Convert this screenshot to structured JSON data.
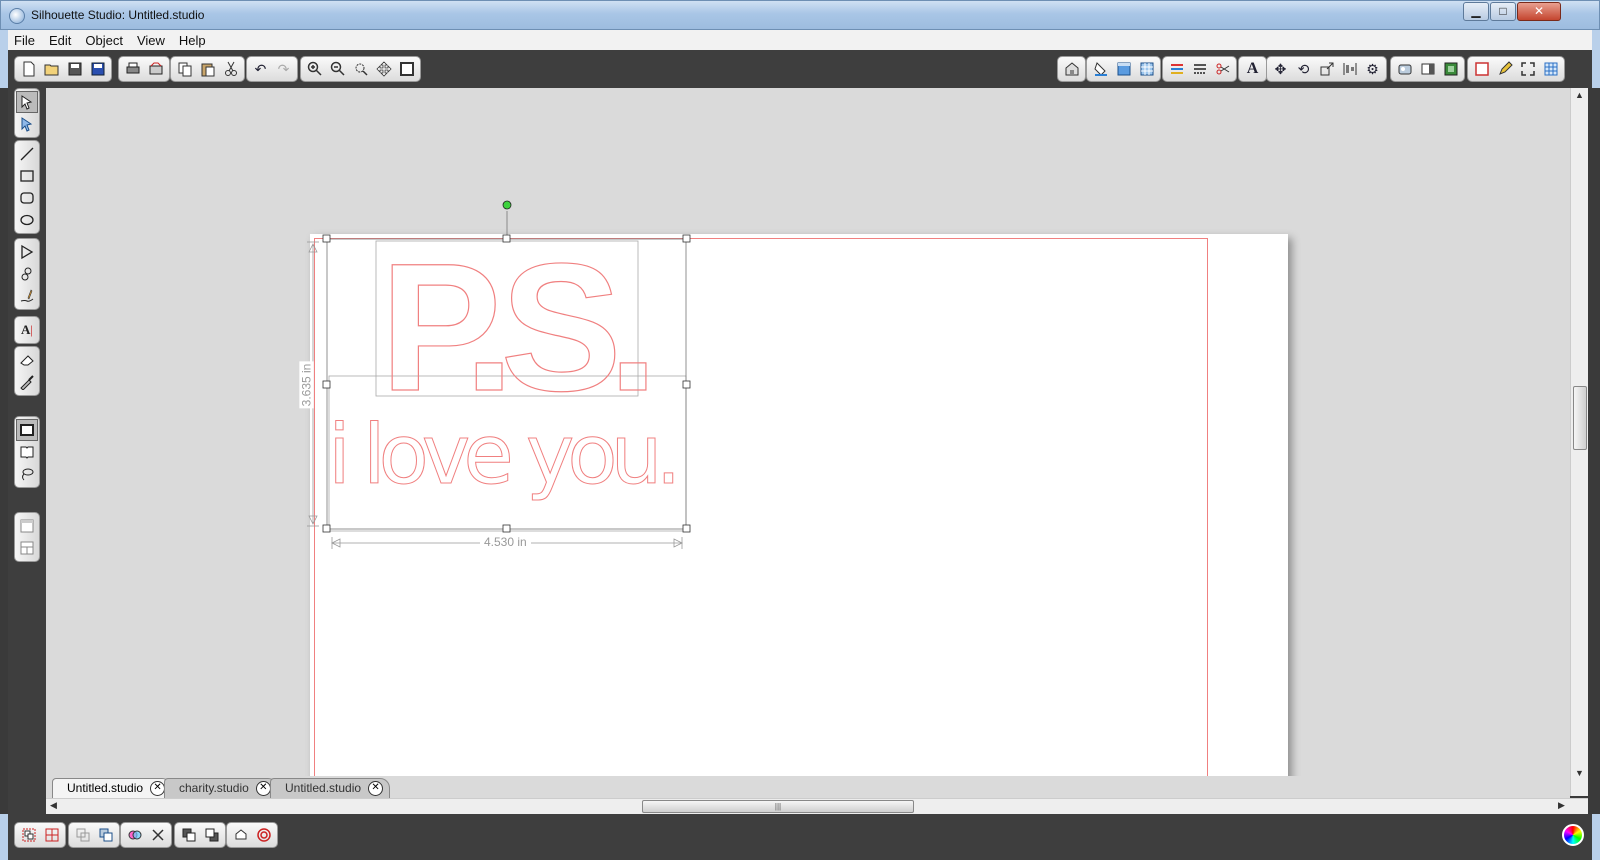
{
  "window": {
    "title": "Silhouette Studio: Untitled.studio",
    "buttons": {
      "minimize": "▁",
      "maximize": "□",
      "close": "✕"
    }
  },
  "menu": [
    "File",
    "Edit",
    "Object",
    "View",
    "Help"
  ],
  "toolbar_icons_left": [
    "new-icon",
    "open-icon",
    "save-icon",
    "save-to-library-icon",
    "print-icon",
    "print-cut-icon",
    "copy-icon",
    "paste-icon",
    "cut-icon",
    "undo-icon",
    "redo-icon",
    "zoom-in-icon",
    "zoom-out-icon",
    "zoom-select-icon",
    "pan-icon",
    "fit-page-icon"
  ],
  "toolbar_icons_right": [
    "store-icon",
    "fill-color-icon",
    "page-setup-icon",
    "registration-icon",
    "line-color-icon",
    "line-style-icon",
    "cut-settings-icon",
    "text-icon",
    "replicate-icon",
    "rotate-icon",
    "scale-icon",
    "align-icon",
    "transform-icon",
    "offset-icon",
    "trace-icon",
    "library-icon",
    "sketch-icon",
    "fullscreen-icon",
    "grid-icon"
  ],
  "left_tools": [
    "select-tool",
    "edit-points-tool",
    "line-tool",
    "rectangle-tool",
    "rounded-rectangle-tool",
    "ellipse-tool",
    "polygon-tool",
    "curve-tool",
    "freehand-tool",
    "text-tool",
    "eraser-tool",
    "knife-tool",
    "page-view-tool",
    "library-tool",
    "lasso-tool",
    "panel-top-tool",
    "panel-split-tool"
  ],
  "dimensions": {
    "height": "3.635 in",
    "width": "4.530 in"
  },
  "design_text": {
    "line1": "P.S.",
    "line2": "i love you."
  },
  "tabs": [
    {
      "label": "Untitled.studio",
      "active": true
    },
    {
      "label": "charity.studio",
      "active": false
    },
    {
      "label": "Untitled.studio",
      "active": false
    }
  ],
  "scroll_thumb": "|||",
  "bottom_icons": [
    "group-icon",
    "ungroup-icon",
    "make-compound-icon",
    "release-compound-icon",
    "weld-icon",
    "delete-icon",
    "bring-forward-icon",
    "send-backward-icon",
    "cut-style-icon",
    "target-icon"
  ],
  "colors": {
    "cut_line": "#f08080",
    "chrome": "#3e3e3e",
    "canvas_bg": "#dadada",
    "handle_green": "#3dd23d"
  }
}
